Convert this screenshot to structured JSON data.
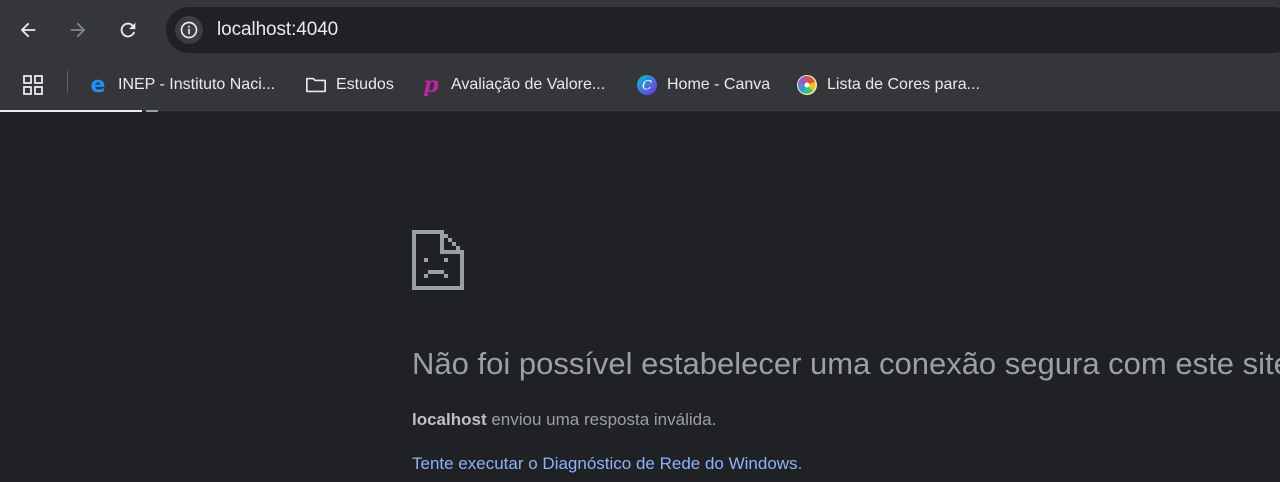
{
  "toolbar": {
    "back_icon": "arrow-left-icon",
    "forward_icon": "arrow-right-icon",
    "reload_icon": "reload-icon",
    "site_info_icon": "info-icon",
    "url": "localhost:4040"
  },
  "bookmarks": {
    "apps_icon": "apps-grid-icon",
    "items": [
      {
        "label": "INEP - Instituto Naci...",
        "icon": "edge-e-icon"
      },
      {
        "label": "Estudos",
        "icon": "folder-icon"
      },
      {
        "label": "Avaliação de Valore...",
        "icon": "p-logo-icon"
      },
      {
        "label": "Home - Canva",
        "icon": "canva-icon"
      },
      {
        "label": "Lista de Cores para...",
        "icon": "color-wheel-icon"
      }
    ]
  },
  "error": {
    "icon": "sad-page-icon",
    "title": "Não foi possível estabelecer uma conexão segura com este site",
    "host": "localhost",
    "description": " enviou uma resposta inválida.",
    "link_text": "Tente executar o Diagnóstico de Rede do Windows",
    "link_suffix": "."
  },
  "colors": {
    "toolbar_bg": "#35363a",
    "page_bg": "#202124",
    "text_secondary": "#9aa0a6",
    "link": "#8ab4f8"
  }
}
